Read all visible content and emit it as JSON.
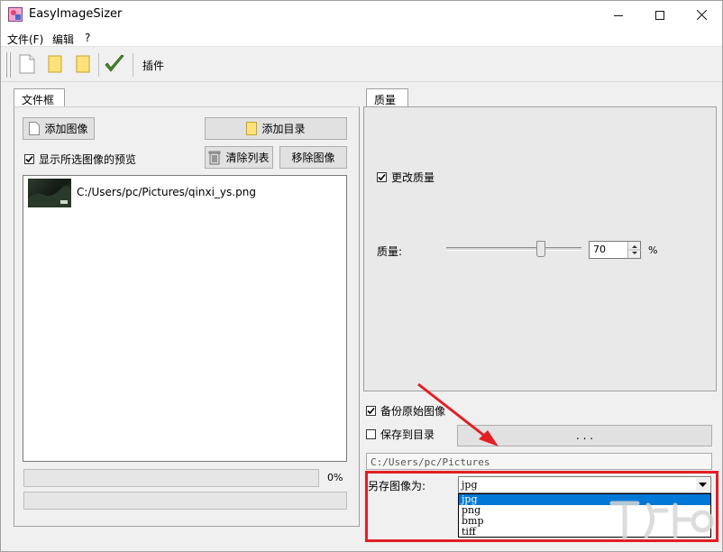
{
  "window": {
    "title": "EasyImageSizer"
  },
  "menu": {
    "items": [
      "文件(F)",
      "编辑",
      "?"
    ]
  },
  "toolbar": {
    "plugin_label": "插件"
  },
  "left_panel": {
    "tab_label": "文件框",
    "add_image_label": "添加图像",
    "add_dir_label": "添加目录",
    "preview_checkbox_label": "显示所选图像的预览",
    "preview_checked": true,
    "clear_list_label": "清除列表",
    "remove_image_label": "移除图像",
    "files": [
      {
        "path": "C:/Users/pc/Pictures/qinxi_ys.png"
      }
    ],
    "progress_text": "0%",
    "progress": 0
  },
  "right_panel": {
    "tab_label": "质量",
    "change_quality_label": "更改质量",
    "change_quality_checked": true,
    "quality_label": "质量:",
    "quality_value": "70",
    "quality_unit": "%",
    "quality_level": 70
  },
  "options": {
    "backup_label": "备份原始图像",
    "backup_checked": true,
    "save_to_dir_label": "保存到目录",
    "save_to_dir_checked": false,
    "browse_label": ". . .",
    "dir_path": "C:/Users/pc/Pictures",
    "save_as_label": "另存图像为:",
    "format_selected": "jpg",
    "format_options": [
      "jpg",
      "png",
      "bmp",
      "tiff"
    ]
  },
  "colors": {
    "highlight": "#e31e24",
    "arrow": "#e31e24",
    "selection": "#0078d7",
    "check_green": "#4a8a2a"
  }
}
